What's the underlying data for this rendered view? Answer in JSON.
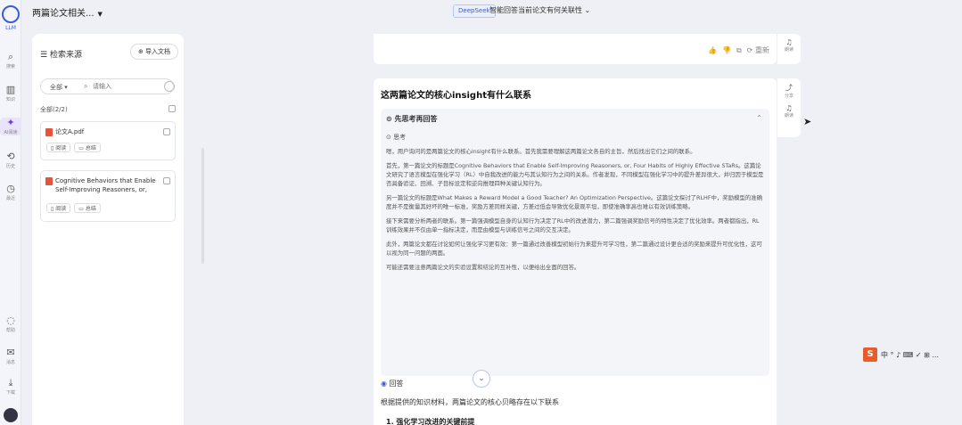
{
  "rail": {
    "logo_label": "LLM",
    "items": [
      {
        "icon": "search-icon",
        "glyph": "⌕",
        "label": "搜索"
      },
      {
        "icon": "library-icon",
        "glyph": "▥",
        "label": "知识"
      },
      {
        "icon": "ai-star-icon",
        "glyph": "✦",
        "label": "AI阅读"
      },
      {
        "icon": "history-icon",
        "glyph": "⟲",
        "label": "历史"
      },
      {
        "icon": "clock-icon",
        "glyph": "◷",
        "label": "最近"
      }
    ],
    "bottom_items": [
      {
        "icon": "bulb-icon",
        "glyph": "◌",
        "label": "帮助"
      },
      {
        "icon": "mail-icon",
        "glyph": "✉",
        "label": "消息"
      },
      {
        "icon": "download-icon",
        "glyph": "⤓",
        "label": "下载"
      }
    ]
  },
  "topbar": {
    "conversation_title": "两篇论文相关...",
    "model_badge": "DeepSeek",
    "center_title": "智能回答当前论文有何关联性"
  },
  "panel": {
    "title": "检索来源",
    "import_button": "导入文档",
    "search_scope": "全部",
    "search_placeholder": "请输入",
    "all_label": "全部(2/2)",
    "docs": [
      {
        "name": "论文A.pdf",
        "actions": [
          "阅读",
          "总结"
        ]
      },
      {
        "name": "Cognitive Behaviors that Enable Self-Improving Reasoners, or,",
        "actions": [
          "阅读",
          "总结"
        ]
      }
    ]
  },
  "chat": {
    "prev_tools": [
      "👍",
      "👎",
      "⧉",
      "⟳ 重新"
    ],
    "question": "这两篇论文的核心insight有什么联系",
    "think_title": "先思考再回答",
    "think_sub": "思考",
    "think_paragraphs": [
      "嗯，用户询问的是两篇论文的核心insight有什么联系。首先我需要理解这两篇论文各自的主旨，然后找出它们之间的联系。",
      "首先，第一篇论文的标题是Cognitive Behaviors that Enable Self-Improving Reasoners, or, Four Habits of Highly Effective STaRs。这篇论文研究了语言模型在强化学习（RL）中自我改进的能力与其认知行为之间的关系。作者发现，不同模型在强化学习中的提升差异很大，并归因于模型是否具备验证、回溯、子目标设定和逆向推理四种关键认知行为。",
      "另一篇论文的标题是What Makes a Reward Model a Good Teacher? An Optimization Perspective。这篇论文探讨了RLHF中，奖励模型的准确度并不是衡量其好坏的唯一标准，奖励方差同样关键，方差过低会导致优化景观平坦，即使准确率高也难以有效训练策略。",
      "接下来需要分析两者的联系。第一篇强调模型自身的认知行为决定了RL中的改进潜力，第二篇强调奖励信号的特性决定了优化效率。两者都指出，RL训练效果并不仅由单一指标决定，而是由模型与训练信号之间的交互决定。",
      "此外，两篇论文都在讨论如何让强化学习更有效：第一篇通过改善模型初始行为来提升可学习性，第二篇通过设计更合适的奖励来提升可优化性，这可以视为同一问题的两面。",
      "可能还需要注意两篇论文的实验设置和结论的互补性，以便给出全面的回答。"
    ],
    "answer_title": "回答",
    "answer_intro": "根据提供的知识材料，两篇论文的核心贝略存在以下联系",
    "answer_subheading": "1. 强化学习改进的关键前提"
  },
  "side_tools_top": [
    {
      "icon": "headphones-icon",
      "glyph": "♫",
      "label": "朗读"
    }
  ],
  "side_tools_mid": [
    {
      "icon": "share-icon",
      "glyph": "⤴",
      "label": "分享"
    },
    {
      "icon": "headphones-icon",
      "glyph": "♫",
      "label": "朗读"
    }
  ],
  "ime": {
    "logo": "S",
    "options": "中 ° ♪ ⌨ ✓ ⊞ ..."
  }
}
